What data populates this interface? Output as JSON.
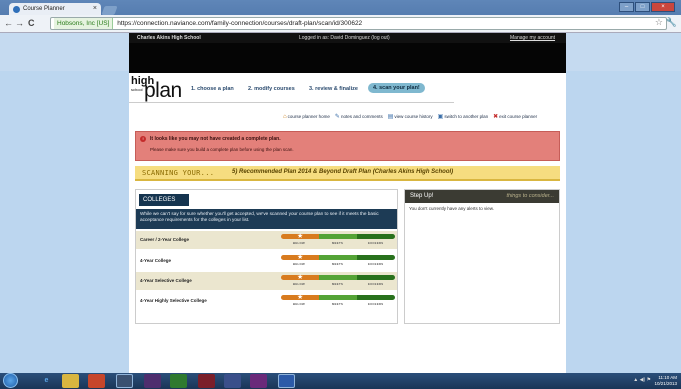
{
  "browser": {
    "tab_title": "Course Planner",
    "tab_close": "×",
    "secure_label": "Hobsons, Inc [US]",
    "url": "https://connection.naviance.com/family-connection/courses/draft-plan/scan/id/300622",
    "back": "←",
    "forward": "→",
    "reload": "C",
    "star": "☆",
    "wrench": "🔧",
    "win_min": "–",
    "win_max": "□",
    "win_close": "×"
  },
  "site": {
    "school": "Charles Akins High School",
    "logged_in": "Logged in as: David Dominguez (log out)",
    "manage_account": "Manage my account"
  },
  "logo": {
    "high": "high",
    "school": "school",
    "plan": "plan"
  },
  "steps": [
    {
      "label": "1. choose a plan"
    },
    {
      "label": "2. modify courses"
    },
    {
      "label": "3. review & finalize"
    },
    {
      "label": "4. scan your plan!"
    }
  ],
  "util_links": [
    {
      "icon": "⌂",
      "label": "course planner home"
    },
    {
      "icon": "✎",
      "label": "notes and comments"
    },
    {
      "icon": "▤",
      "label": "view course history"
    },
    {
      "icon": "▣",
      "label": "switch to another plan"
    },
    {
      "icon": "✖",
      "label": "exit course planner"
    }
  ],
  "alert": {
    "icon": "!",
    "title": "It looks like you may not have created a complete plan.",
    "body": "Please make sure you build a complete plan before using the plan scan."
  },
  "scan": {
    "label": "SCANNING YOUR...",
    "plan": "5) Recommended Plan 2014 & Beyond Draft Plan (Charles Akins High School)"
  },
  "colleges": {
    "tab": "COLLEGES",
    "description": "While we can't say for sure whether you'll get accepted, we've scanned your course plan to see if it meets the basic acceptance requirements for the colleges in your list.",
    "scale": [
      "BELOW",
      "MEETS",
      "EXCEEDS"
    ],
    "marker": "★",
    "rows": [
      {
        "label": "Career / 2-Year College",
        "level": "below"
      },
      {
        "label": "4-Year College",
        "level": "below"
      },
      {
        "label": "4-Year Selective College",
        "level": "below"
      },
      {
        "label": "4-Year Highly Selective College",
        "level": "below"
      }
    ]
  },
  "stepup": {
    "title": "Step Up!",
    "subtitle": "things to consider...",
    "message": "You don't currently have any alerts to view."
  },
  "taskbar": {
    "clock_time": "11:10 AM",
    "clock_date": "10/21/2013",
    "tray": "▲  ◀)  ⚑"
  },
  "colors": {
    "alert_bg": "#e3807a",
    "scan_bg": "#f6dd80",
    "navy": "#15344f",
    "meter_below": "#d87b1e",
    "meter_meets": "#54a336",
    "meter_exceeds": "#28711c"
  }
}
